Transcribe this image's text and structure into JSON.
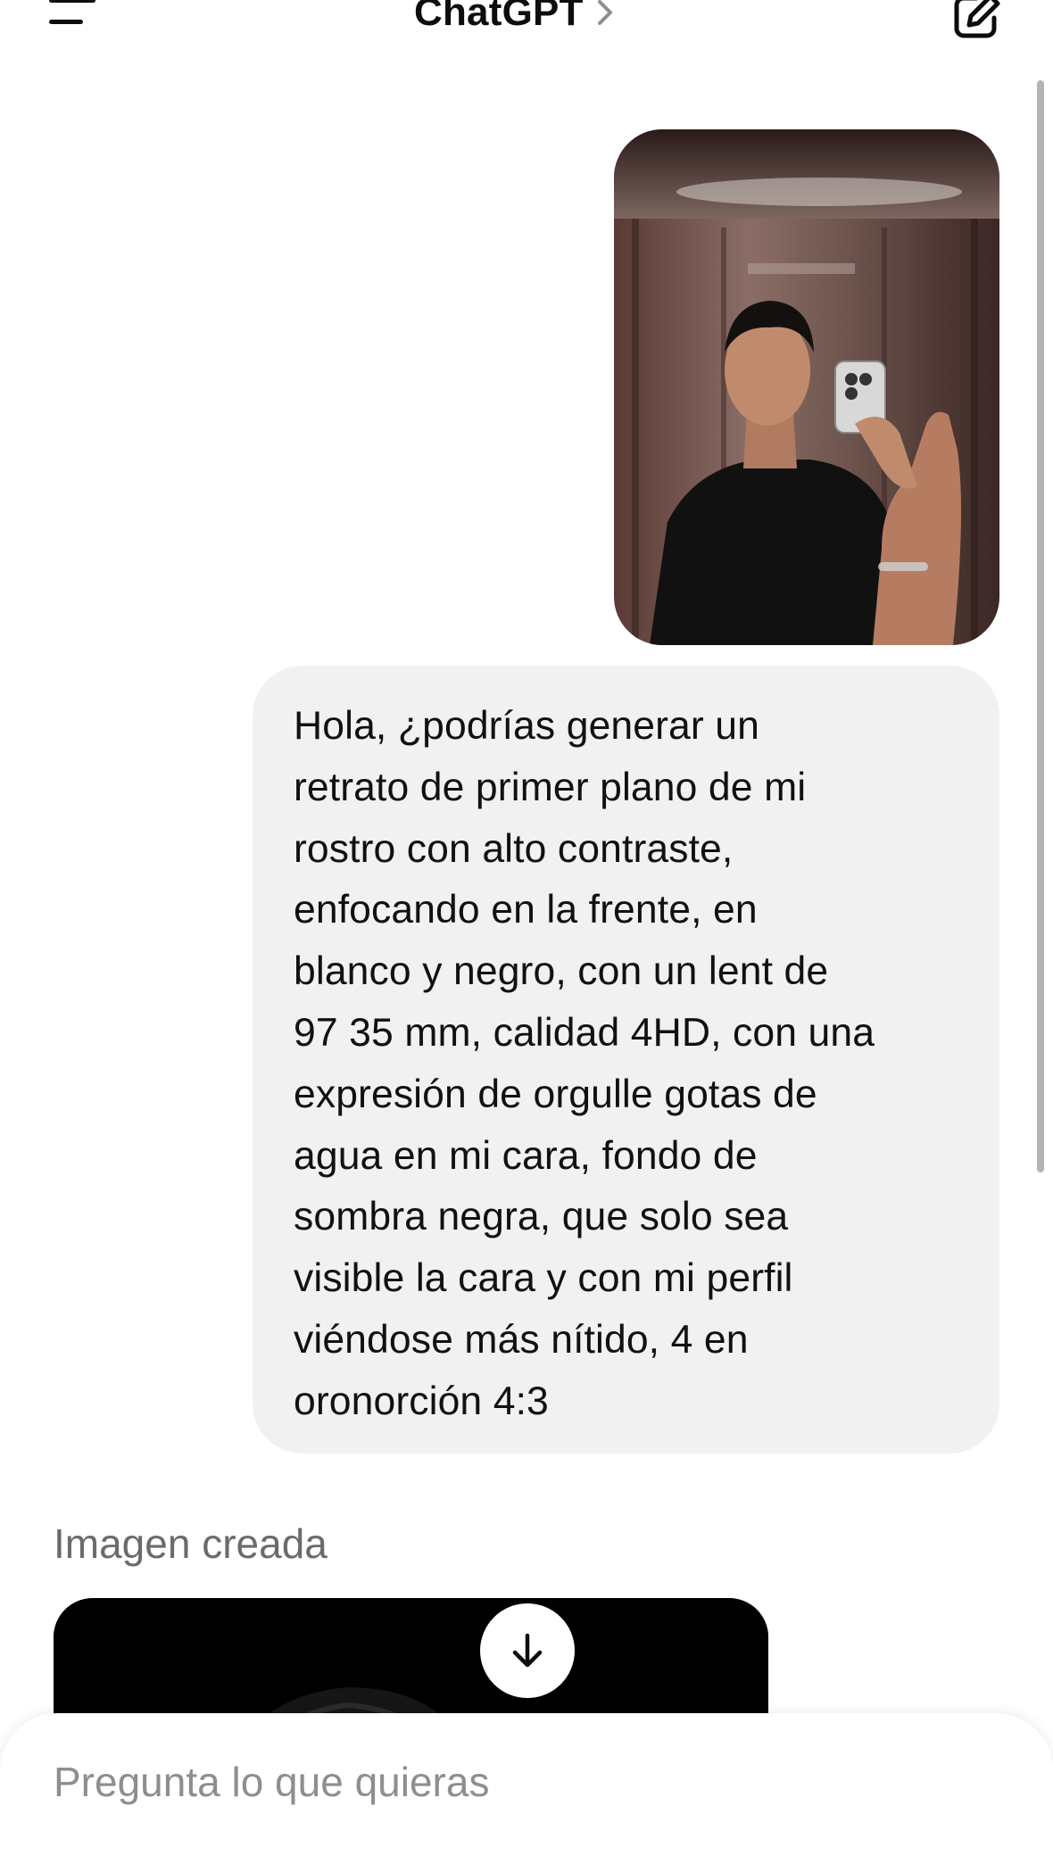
{
  "header": {
    "title": "ChatGPT",
    "menu_icon": "menu-icon",
    "chevron_icon": "chevron-right-icon",
    "edit_icon": "new-chat-icon"
  },
  "conversation": {
    "user_image": {
      "icon": "uploaded-photo"
    },
    "user_message": "Hola, ¿podrías generar un\nretrato de primer plano de mi\nrostro con alto contraste,\nenfocando en la frente, en\nblanco y negro, con un lent de\n97 35 mm, calidad 4HD, con una\nexpresión de orgulle gotas de\nagua en mi cara, fondo de\nsombra negra, que solo sea\nvisible la cara y con mi perfil\nviéndose más nítido, 4 en\noronorción 4:3",
    "assistant": {
      "label": "Imagen creada",
      "image_icon": "generated-image"
    }
  },
  "scroll_down_icon": "arrow-down-icon",
  "composer": {
    "placeholder": "Pregunta lo que quieras",
    "value": ""
  },
  "colors": {
    "background": "#ffffff",
    "user_bubble": "#f1f1f1",
    "muted_text": "#6b6b6b",
    "placeholder": "#8e8e8e"
  }
}
